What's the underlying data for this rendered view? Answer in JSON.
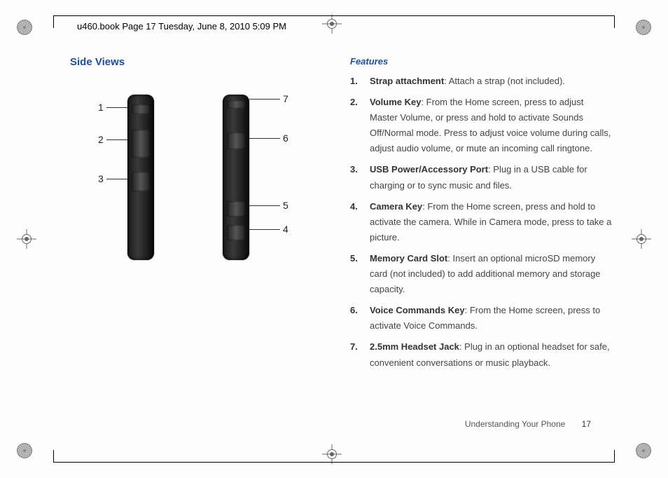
{
  "header": {
    "doc_label": "u460.book  Page 17  Tuesday, June 8, 2010  5:09 PM"
  },
  "left": {
    "heading": "Side Views",
    "callouts_left": [
      "1",
      "2",
      "3"
    ],
    "callouts_right": [
      "7",
      "6",
      "5",
      "4"
    ]
  },
  "right": {
    "heading": "Features",
    "items": [
      {
        "term": "Strap attachment",
        "desc": ": Attach a strap (not included)."
      },
      {
        "term": "Volume Key",
        "desc": ": From the Home screen, press to adjust Master Volume, or press and hold to activate Sounds Off/Normal mode. Press to adjust voice volume during calls, adjust audio volume, or mute an incoming call ringtone."
      },
      {
        "term": "USB Power/Accessory Port",
        "desc": ": Plug in a USB cable for charging or to sync music and files."
      },
      {
        "term": "Camera Key",
        "desc": ": From the Home screen, press and hold to activate the camera. While in Camera mode, press to take a picture."
      },
      {
        "term": "Memory Card Slot",
        "desc": ": Insert an optional microSD memory card (not included) to add additional memory and storage capacity."
      },
      {
        "term": "Voice Commands Key",
        "desc": ": From the Home screen, press to activate Voice Commands."
      },
      {
        "term": "2.5mm Headset Jack",
        "desc": ": Plug in an optional headset for safe, convenient conversations or music playback."
      }
    ]
  },
  "footer": {
    "section": "Understanding Your Phone",
    "page": "17"
  }
}
